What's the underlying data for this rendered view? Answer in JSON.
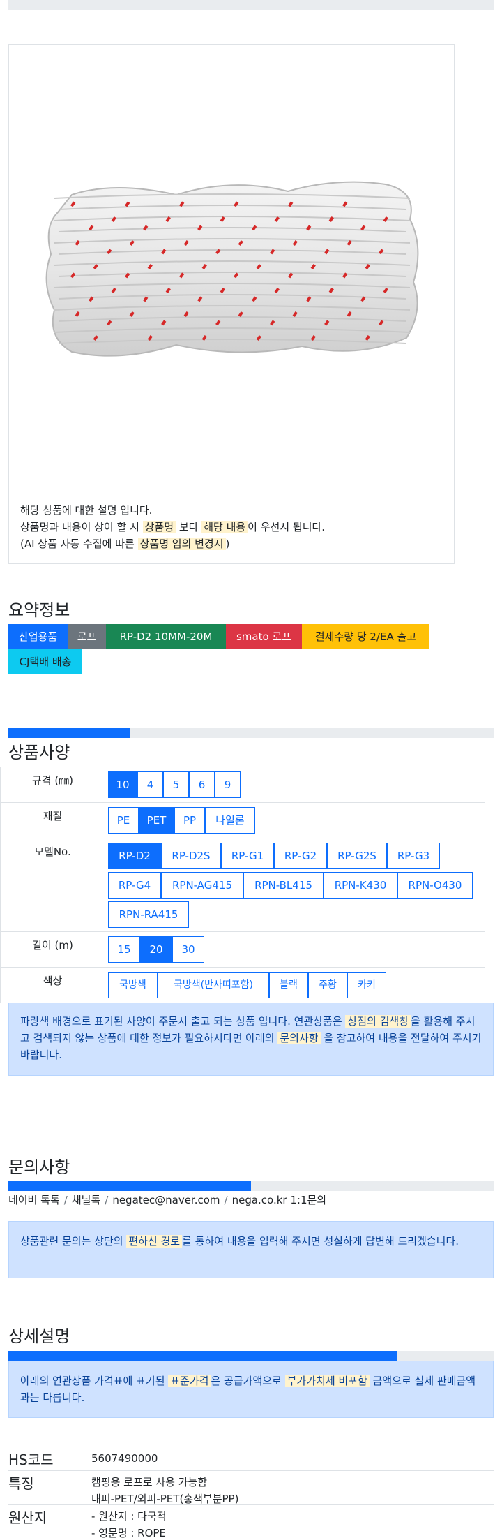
{
  "product": {
    "desc_line1": "해당 상품에 대한 설명 입니다.",
    "desc_line2_a": "상품명과 내용이 상이 할 시 ",
    "desc_line2_hl1": "상품명",
    "desc_line2_b": " 보다 ",
    "desc_line2_hl2": "해당 내용",
    "desc_line2_c": "이 우선시 됩니다.",
    "desc_line3_a": "(AI 상품 자동 수집에 따른 ",
    "desc_line3_hl": "상품명 임의 변경시",
    "desc_line3_b": ")"
  },
  "summary": {
    "title": "요약정보",
    "badges": [
      {
        "label": "산업용품",
        "color": "#0d6efd"
      },
      {
        "label": "로프",
        "color": "#6c757d"
      },
      {
        "label": "RP-D2 10MM-20M",
        "color": "#198754"
      },
      {
        "label": "smato 로프",
        "color": "#dc3545"
      },
      {
        "label": "결제수량 당 2/EA 출고",
        "color": "#ffc107"
      },
      {
        "label": "CJ택배 배송",
        "color": "#0dcaf0"
      }
    ]
  },
  "specs": {
    "title": "상품사양",
    "progress_percent": 25,
    "rows": [
      {
        "label": "규격 (㎜)",
        "options": [
          "10",
          "4",
          "5",
          "6",
          "9"
        ],
        "selected": "10"
      },
      {
        "label": "재질",
        "options": [
          "PE",
          "PET",
          "PP",
          "나일론"
        ],
        "selected": "PET"
      },
      {
        "label": "모델No.",
        "options": [
          "RP-D2",
          "RP-D2S",
          "RP-G1",
          "RP-G2",
          "RP-G2S",
          "RP-G3",
          "RP-G4",
          "RPN-AG415",
          "RPN-BL415",
          "RPN-K430",
          "RPN-O430",
          "RPN-RA415"
        ],
        "selected": "RP-D2"
      },
      {
        "label": "길이 (m)",
        "options": [
          "15",
          "20",
          "30"
        ],
        "selected": "20"
      },
      {
        "label": "색상",
        "options": [
          "국방색",
          "국방색(반사띠포함)",
          "블랙",
          "주황",
          "카키"
        ],
        "selected": ""
      }
    ],
    "notice_a": "파랑색 배경으로 표기된 사양이 주문시 출고 되는 상품 입니다. 연관상품은 ",
    "notice_hl1": "상점의 검색창",
    "notice_b": "을 활용해 주시고 검색되지 않는 상품에 대한 정보가 필요하시다면 아래의 ",
    "notice_hl2": "문의사항",
    "notice_c": " 을 참고하여 내용을 전달하여 주시기 바랍니다."
  },
  "inquiry": {
    "title": "문의사항",
    "progress_percent": 50,
    "contacts": [
      "네이버 톡톡",
      "채널톡",
      "negatec@naver.com",
      "nega.co.kr 1:1문의"
    ],
    "notice_a": "상품관련 문의는 상단의 ",
    "notice_hl": "편하신 경로",
    "notice_b": "를 통하여 내용을 입력해 주시면 성실하게 답변해 드리겠습니다."
  },
  "detail": {
    "title": "상세설명",
    "progress_percent": 80,
    "notice_a": "아래의 연관상품 가격표에 표기된 ",
    "notice_hl1": "표준가격",
    "notice_b": "은 공급가액으로 ",
    "notice_hl2": "부가가치세 비포함",
    "notice_c": " 금액으로 실제 판매금액과는 다릅니다.",
    "rows": [
      {
        "key": "HS코드",
        "lines": [
          "5607490000"
        ]
      },
      {
        "key": "특징",
        "lines": [
          "캠핑용 로프로 사용 가능함",
          "내피-PET/외피-PET(홍색부분PP)"
        ]
      },
      {
        "key": "원산지",
        "lines": [
          "- 원산지 : 다국적",
          "- 영문명 : ROPE"
        ]
      }
    ]
  }
}
